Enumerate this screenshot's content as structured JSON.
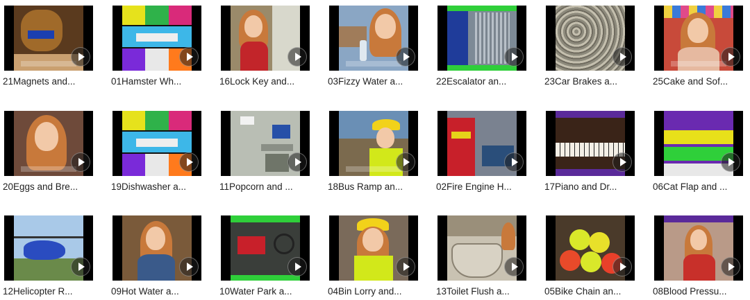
{
  "videos": [
    {
      "title": "21Magnets and...",
      "icon": "play-icon"
    },
    {
      "title": "01Hamster Wh...",
      "icon": "play-icon"
    },
    {
      "title": "16Lock Key and...",
      "icon": "play-icon"
    },
    {
      "title": "03Fizzy Water a...",
      "icon": "play-icon"
    },
    {
      "title": "22Escalator an...",
      "icon": "play-icon"
    },
    {
      "title": "23Car Brakes a...",
      "icon": "play-icon"
    },
    {
      "title": "25Cake and Sof...",
      "icon": "play-icon"
    },
    {
      "title": "20Eggs and Bre...",
      "icon": "play-icon"
    },
    {
      "title": "19Dishwasher a...",
      "icon": "play-icon"
    },
    {
      "title": "11Popcorn and ...",
      "icon": "play-icon"
    },
    {
      "title": "18Bus Ramp an...",
      "icon": "play-icon"
    },
    {
      "title": "02Fire Engine H...",
      "icon": "play-icon"
    },
    {
      "title": "17Piano and Dr...",
      "icon": "play-icon"
    },
    {
      "title": "06Cat Flap and ...",
      "icon": "play-icon"
    },
    {
      "title": "12Helicopter R...",
      "icon": "play-icon"
    },
    {
      "title": "09Hot Water a...",
      "icon": "play-icon"
    },
    {
      "title": "10Water Park a...",
      "icon": "play-icon"
    },
    {
      "title": "04Bin Lorry and...",
      "icon": "play-icon"
    },
    {
      "title": "13Toilet Flush a...",
      "icon": "play-icon"
    },
    {
      "title": "05Bike Chain an...",
      "icon": "play-icon"
    },
    {
      "title": "08Blood Pressu...",
      "icon": "play-icon"
    }
  ],
  "colors": {
    "background": "#ffffff",
    "label_text": "#222222",
    "letterbox": "#000000"
  }
}
